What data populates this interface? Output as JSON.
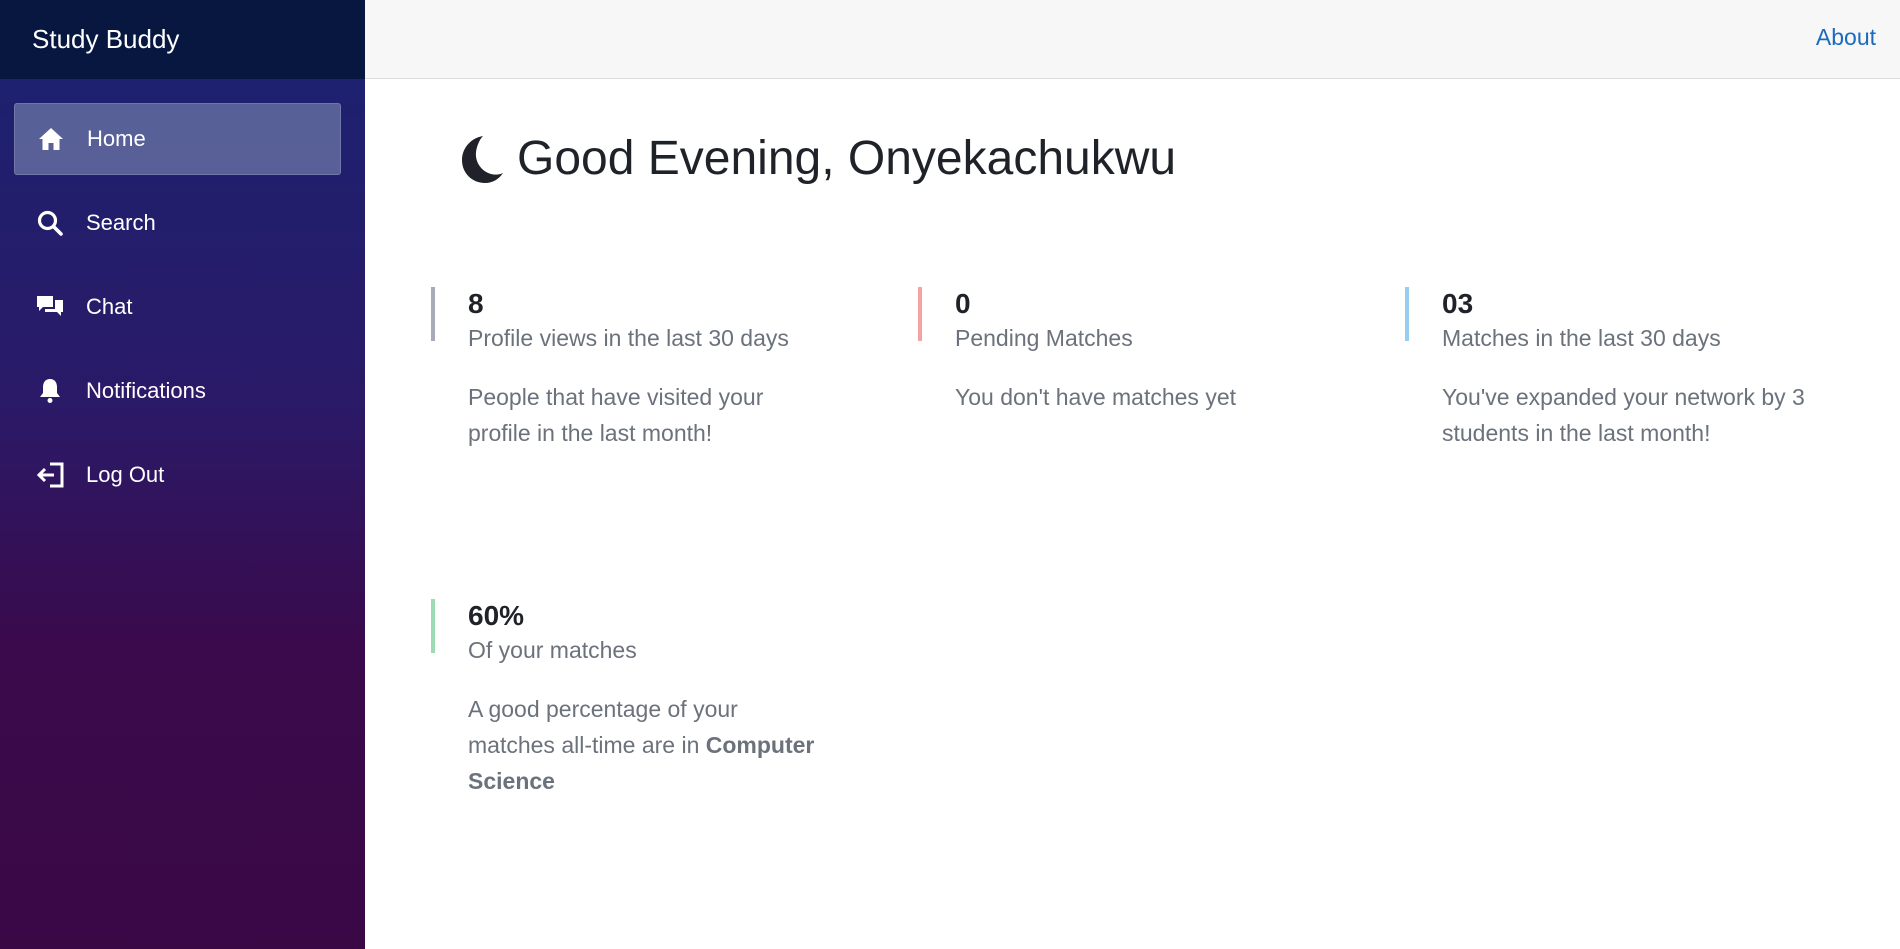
{
  "app": {
    "brand": "Study Buddy"
  },
  "sidebar": {
    "items": [
      {
        "label": "Home",
        "icon": "home-icon",
        "active": true
      },
      {
        "label": "Search",
        "icon": "search-icon",
        "active": false
      },
      {
        "label": "Chat",
        "icon": "chat-icon",
        "active": false
      },
      {
        "label": "Notifications",
        "icon": "bell-icon",
        "active": false
      },
      {
        "label": "Log Out",
        "icon": "logout-icon",
        "active": false
      }
    ]
  },
  "header": {
    "about_label": "About"
  },
  "main": {
    "greeting": "Good Evening, Onyekachukwu",
    "greeting_icon": "moon-icon",
    "stats": [
      {
        "value": "8",
        "label": "Profile views in the last 30 days",
        "description": "People that have visited your profile in the last month!",
        "accent": "#a7abb8"
      },
      {
        "value": "0",
        "label": "Pending Matches",
        "description": "You don't have matches yet",
        "accent": "#f3a3a3"
      },
      {
        "value": "03",
        "label": "Matches in the last 30 days",
        "description": "You've expanded your network by 3 students in the last month!",
        "accent": "#98cdef"
      },
      {
        "value": "60%",
        "label": "Of your matches",
        "description_prefix": "A good percentage of your matches all-time are in ",
        "description_bold": "Computer Science",
        "accent": "#9bdcb4"
      }
    ]
  },
  "colors": {
    "link": "#1a6bbf",
    "brand_bg": "#07173f"
  }
}
